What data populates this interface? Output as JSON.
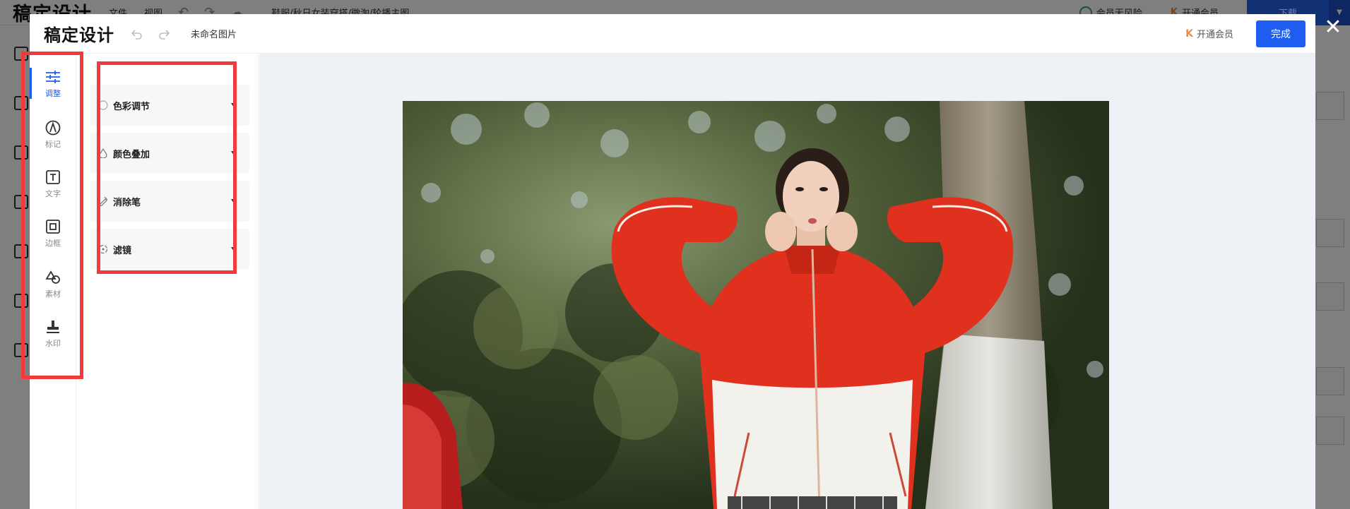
{
  "background_app": {
    "logo": "稿定设计",
    "menu": [
      "文件",
      "视图"
    ],
    "doc_title": "鞋服/秋日女装穿搭/微淘/轮播主图",
    "risk_label": "会员无风险",
    "vip_label": "开通会员",
    "download_label": "下载"
  },
  "header": {
    "logo": "稿定设计",
    "doc_name": "未命名图片",
    "vip_label": "开通会员",
    "done_label": "完成",
    "close_glyph": "✕"
  },
  "tools": [
    {
      "label": "调整",
      "icon": "sliders-icon",
      "active": true
    },
    {
      "label": "标记",
      "icon": "pen-nib-icon",
      "active": false
    },
    {
      "label": "文字",
      "icon": "text-box-icon",
      "active": false
    },
    {
      "label": "边框",
      "icon": "frame-icon",
      "active": false
    },
    {
      "label": "素材",
      "icon": "shapes-icon",
      "active": false
    },
    {
      "label": "水印",
      "icon": "stamp-icon",
      "active": false
    }
  ],
  "adjust_panel": {
    "items": [
      {
        "label": "色彩调节",
        "icon": "color-circle-icon"
      },
      {
        "label": "颜色叠加",
        "icon": "droplet-icon"
      },
      {
        "label": "消除笔",
        "icon": "eraser-pen-icon"
      },
      {
        "label": "滤镜",
        "icon": "filter-icon"
      }
    ]
  },
  "colors": {
    "accent": "#1f5cf0",
    "annotation": "#f2393b",
    "canvas_bg": "#eef1f6"
  }
}
